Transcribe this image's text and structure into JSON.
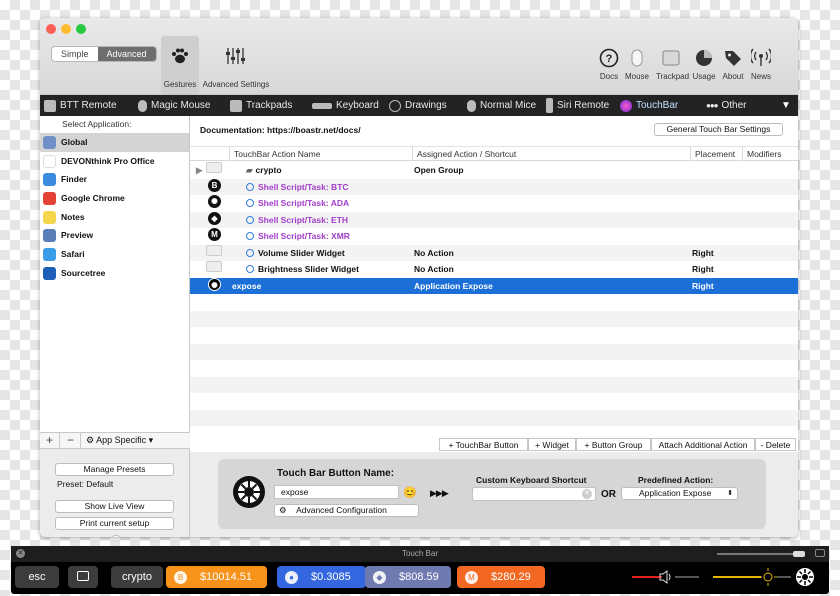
{
  "mode": {
    "simple": "Simple",
    "advanced": "Advanced"
  },
  "toolbar": {
    "gestures": "Gestures",
    "advanced_settings": "Advanced Settings"
  },
  "right_toolbar": [
    {
      "label": "Docs",
      "icon": "question-icon"
    },
    {
      "label": "Mouse",
      "icon": "mouse-icon"
    },
    {
      "label": "Trackpad",
      "icon": "trackpad-icon"
    },
    {
      "label": "Usage",
      "icon": "pie-chart-icon"
    },
    {
      "label": "About",
      "icon": "tag-icon"
    },
    {
      "label": "News",
      "icon": "broadcast-icon"
    }
  ],
  "categories": [
    "BTT Remote",
    "Magic Mouse",
    "Trackpads",
    "Keyboard",
    "Drawings",
    "Normal Mice",
    "Siri Remote",
    "TouchBar",
    "Other"
  ],
  "sidebar": {
    "header": "Select Application:",
    "apps": [
      {
        "name": "Global",
        "color": "#6e8fc8"
      },
      {
        "name": "DEVONthink Pro Office",
        "color": "#ffffff"
      },
      {
        "name": "Finder",
        "color": "#3b8be0"
      },
      {
        "name": "Google Chrome",
        "color": "#e34234"
      },
      {
        "name": "Notes",
        "color": "#f4d64a"
      },
      {
        "name": "Preview",
        "color": "#5a7fb8"
      },
      {
        "name": "Safari",
        "color": "#3a9be6"
      },
      {
        "name": "Sourcetree",
        "color": "#1f5fb8"
      }
    ],
    "plus": "+",
    "minus": "−",
    "app_specific": "App Specific ▾",
    "manage_presets": "Manage Presets",
    "preset": "Preset: Default",
    "show_live_view": "Show Live View",
    "print_setup": "Print current setup",
    "help": "?"
  },
  "main": {
    "documentation": "Documentation: https://boastr.net/docs/",
    "general_settings": "General Touch Bar Settings",
    "columns": [
      "TouchBar Action Name",
      "Assigned Action / Shortcut",
      "Placement",
      "Modifiers"
    ],
    "rows": [
      {
        "name": "crypto",
        "action": "Open Group",
        "placement": "",
        "style": "folder"
      },
      {
        "name": "Shell Script/Task: BTC",
        "action": "",
        "placement": "",
        "style": "coin",
        "glyph": "B"
      },
      {
        "name": "Shell Script/Task: ADA",
        "action": "",
        "placement": "",
        "style": "coin",
        "glyph": "✺"
      },
      {
        "name": "Shell Script/Task: ETH",
        "action": "",
        "placement": "",
        "style": "coin",
        "glyph": "◆"
      },
      {
        "name": "Shell Script/Task: XMR",
        "action": "",
        "placement": "",
        "style": "coin",
        "glyph": "M"
      },
      {
        "name": "Volume Slider Widget",
        "action": "No Action",
        "placement": "Right",
        "style": "widget"
      },
      {
        "name": "Brightness Slider Widget",
        "action": "No Action",
        "placement": "Right",
        "style": "widget"
      },
      {
        "name": "expose",
        "action": "Application Expose",
        "placement": "Right",
        "style": "selected"
      }
    ],
    "actions": [
      "+ TouchBar Button",
      "+ Widget",
      "+ Button Group",
      "Attach Additional Action",
      "- Delete"
    ]
  },
  "editor": {
    "name_label": "Touch Bar Button Name:",
    "name_value": "expose",
    "advanced_config": "Advanced Configuration",
    "shortcut_label": "Custom Keyboard Shortcut",
    "or": "OR",
    "predefined_label": "Predefined Action:",
    "predefined_value": "Application Expose",
    "arrows": "▶▶▶"
  },
  "touchbar": {
    "title": "Touch Bar",
    "esc": "esc",
    "crypto": "crypto",
    "coins": [
      {
        "value": "$10014.51",
        "color": "#f7931a",
        "glyph": "B"
      },
      {
        "value": "$0.3085",
        "color": "#3466e0",
        "glyph": "●"
      },
      {
        "value": "$808.59",
        "color": "#6f7ab0",
        "glyph": "◆"
      },
      {
        "value": "$280.29",
        "color": "#f26822",
        "glyph": "M"
      }
    ]
  }
}
